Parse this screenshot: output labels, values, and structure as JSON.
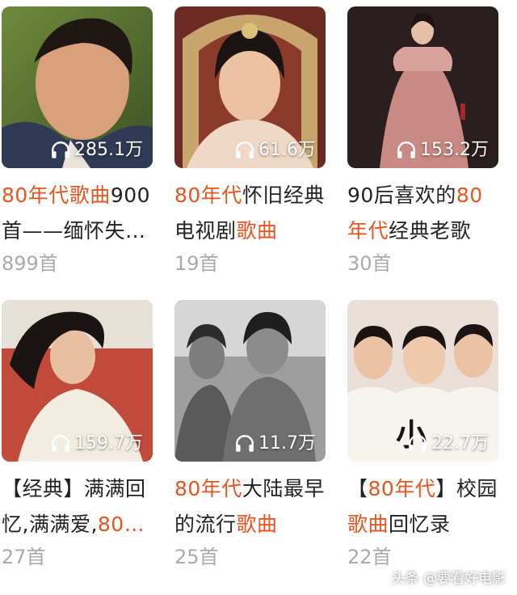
{
  "playlists": [
    {
      "play_count": "285.1万",
      "title_parts": [
        {
          "text": "80年代歌曲",
          "hl": true
        },
        {
          "text": "900首——缅怀失…",
          "hl": false
        }
      ],
      "track_count": "899首",
      "colors": {
        "accent": "#e8541e"
      }
    },
    {
      "play_count": "61.6万",
      "title_parts": [
        {
          "text": "80年代",
          "hl": true
        },
        {
          "text": "怀旧经典电视剧",
          "hl": false
        },
        {
          "text": "歌曲",
          "hl": true
        }
      ],
      "track_count": "19首"
    },
    {
      "play_count": "153.2万",
      "title_parts": [
        {
          "text": "90后喜欢的",
          "hl": false
        },
        {
          "text": "80年代",
          "hl": true
        },
        {
          "text": "经典老歌",
          "hl": false
        }
      ],
      "track_count": "30首"
    },
    {
      "play_count": "159.7万",
      "title_parts": [
        {
          "text": "【经典】满满回忆,满满爱,",
          "hl": false
        },
        {
          "text": "80…",
          "hl": true
        }
      ],
      "track_count": "27首"
    },
    {
      "play_count": "11.7万",
      "title_parts": [
        {
          "text": "80年代",
          "hl": true
        },
        {
          "text": "大陆最早的流行",
          "hl": false
        },
        {
          "text": "歌曲",
          "hl": true
        }
      ],
      "track_count": "25首"
    },
    {
      "play_count": "22.7万",
      "title_parts": [
        {
          "text": "【",
          "hl": false
        },
        {
          "text": "80年代",
          "hl": true
        },
        {
          "text": "】校园",
          "hl": false
        },
        {
          "text": "歌曲",
          "hl": true
        },
        {
          "text": "回忆录",
          "hl": false
        }
      ],
      "track_count": "22首"
    }
  ],
  "watermark": "头条 @要看好电影",
  "icons": {
    "play_count": "headphones-icon"
  },
  "colors": {
    "highlight": "#e8541e",
    "text": "#222222",
    "muted": "#aaaaaa"
  }
}
